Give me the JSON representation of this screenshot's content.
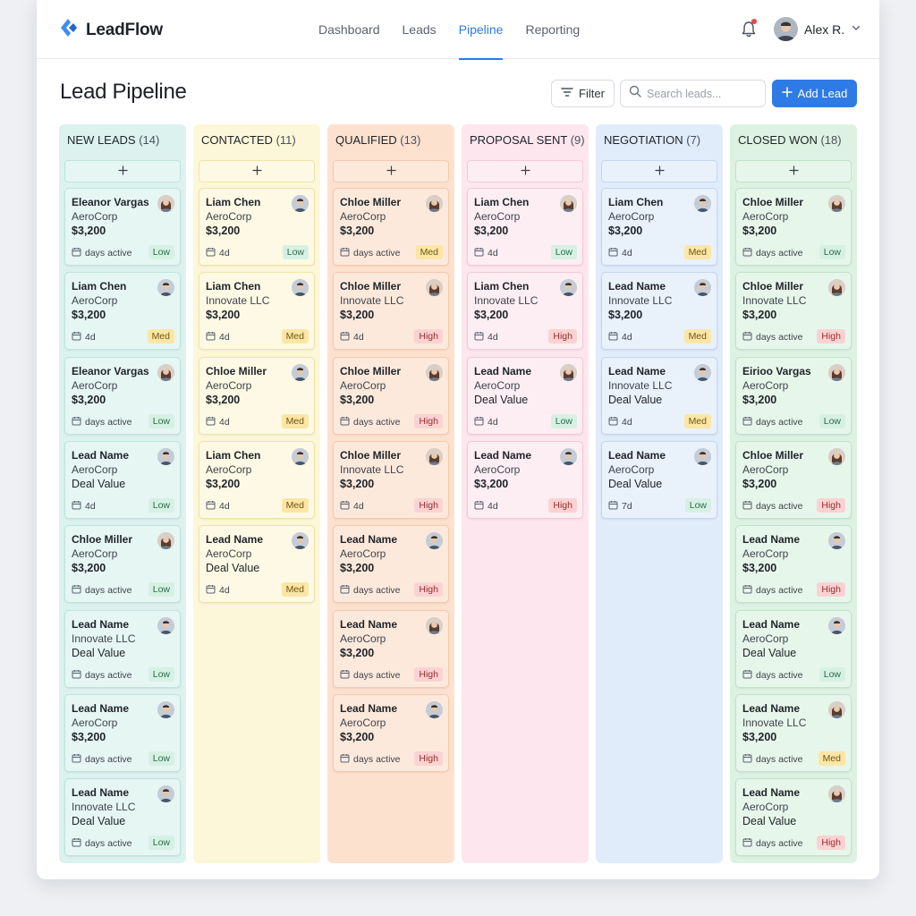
{
  "app": {
    "name": "LeadFlow"
  },
  "nav": [
    {
      "label": "Dashboard",
      "active": false
    },
    {
      "label": "Leads",
      "active": false
    },
    {
      "label": "Pipeline",
      "active": true
    },
    {
      "label": "Reporting",
      "active": false
    }
  ],
  "user": {
    "name": "Alex R."
  },
  "page": {
    "title": "Lead Pipeline"
  },
  "toolbar": {
    "filter_label": "Filter",
    "search_placeholder": "Search leads...",
    "add_label": "Add Lead"
  },
  "colors": {
    "accent": "#2f7be5",
    "notification": "#e5484d"
  },
  "columns": [
    {
      "title": "NEW LEADS",
      "count": "(14)",
      "bg": "#dcf2ef",
      "card_bg": "#e6f6f3",
      "border": "#bfe3dc",
      "cards": [
        {
          "name": "Eleanor Vargas",
          "company": "AeroCorp",
          "value": "$3,200",
          "meta": "days active",
          "priority": "Low",
          "avatar": "f"
        },
        {
          "name": "Liam Chen",
          "company": "AeroCorp",
          "value": "$3,200",
          "meta": "4d",
          "priority": "Med",
          "avatar": "m"
        },
        {
          "name": "Eleanor Vargas",
          "company": "AeroCorp",
          "value": "$3,200",
          "meta": "days active",
          "priority": "Low",
          "avatar": "f"
        },
        {
          "name": "Lead Name",
          "company": "AeroCorp",
          "value": "Deal Value",
          "meta": "4d",
          "priority": "Low",
          "avatar": "m"
        },
        {
          "name": "Chloe Miller",
          "company": "AeroCorp",
          "value": "$3,200",
          "meta": "days active",
          "priority": "Low",
          "avatar": "f"
        },
        {
          "name": "Lead Name",
          "company": "Innovate LLC",
          "value": "Deal Value",
          "meta": "days active",
          "priority": "Low",
          "avatar": "m"
        },
        {
          "name": "Lead Name",
          "company": "AeroCorp",
          "value": "$3,200",
          "meta": "days active",
          "priority": "Low",
          "avatar": "m"
        },
        {
          "name": "Lead Name",
          "company": "Innovate LLC",
          "value": "Deal Value",
          "meta": "days active",
          "priority": "Low",
          "avatar": "m"
        }
      ]
    },
    {
      "title": "CONTACTED",
      "count": "(11)",
      "bg": "#fdf7d9",
      "card_bg": "#fdf9e4",
      "border": "#f1e3a6",
      "cards": [
        {
          "name": "Liam Chen",
          "company": "AeroCorp",
          "value": "$3,200",
          "meta": "4d",
          "priority": "Low",
          "avatar": "m"
        },
        {
          "name": "Liam Chen",
          "company": "Innovate LLC",
          "value": "$3,200",
          "meta": "4d",
          "priority": "Med",
          "avatar": "m"
        },
        {
          "name": "Chloe Miller",
          "company": "AeroCorp",
          "value": "$3,200",
          "meta": "4d",
          "priority": "Med",
          "avatar": "m"
        },
        {
          "name": "Liam Chen",
          "company": "AeroCorp",
          "value": "$3,200",
          "meta": "4d",
          "priority": "Med",
          "avatar": "m"
        },
        {
          "name": "Lead Name",
          "company": "AeroCorp",
          "value": "Deal Value",
          "meta": "4d",
          "priority": "Med",
          "avatar": "m"
        }
      ]
    },
    {
      "title": "QUALIFIED",
      "count": "(13)",
      "bg": "#fde1cf",
      "card_bg": "#fde9dc",
      "border": "#f5c9ac",
      "cards": [
        {
          "name": "Chloe Miller",
          "company": "AeroCorp",
          "value": "$3,200",
          "meta": "days active",
          "priority": "Med",
          "avatar": "f"
        },
        {
          "name": "Chloe Miller",
          "company": "Innovate LLC",
          "value": "$3,200",
          "meta": "4d",
          "priority": "High",
          "avatar": "f"
        },
        {
          "name": "Chloe Miller",
          "company": "AeroCorp",
          "value": "$3,200",
          "meta": "days active",
          "priority": "High",
          "avatar": "f"
        },
        {
          "name": "Chloe Miller",
          "company": "Innovate LLC",
          "value": "$3,200",
          "meta": "4d",
          "priority": "High",
          "avatar": "f"
        },
        {
          "name": "Lead Name",
          "company": "AeroCorp",
          "value": "$3,200",
          "meta": "days active",
          "priority": "High",
          "avatar": "m"
        },
        {
          "name": "Lead Name",
          "company": "AeroCorp",
          "value": "$3,200",
          "meta": "days active",
          "priority": "High",
          "avatar": "f"
        },
        {
          "name": "Lead Name",
          "company": "AeroCorp",
          "value": "$3,200",
          "meta": "days active",
          "priority": "High",
          "avatar": "m"
        }
      ]
    },
    {
      "title": "PROPOSAL SENT",
      "count": "(9)",
      "bg": "#fde6ee",
      "card_bg": "#fdeef3",
      "border": "#f4c9d7",
      "cards": [
        {
          "name": "Liam Chen",
          "company": "AeroCorp",
          "value": "$3,200",
          "meta": "4d",
          "priority": "Low",
          "avatar": "f"
        },
        {
          "name": "Liam Chen",
          "company": "Innovate LLC",
          "value": "$3,200",
          "meta": "4d",
          "priority": "High",
          "avatar": "m"
        },
        {
          "name": "Lead Name",
          "company": "AeroCorp",
          "value": "Deal Value",
          "meta": "4d",
          "priority": "Low",
          "avatar": "f"
        },
        {
          "name": "Lead Name",
          "company": "AeroCorp",
          "value": "$3,200",
          "meta": "4d",
          "priority": "High",
          "avatar": "m"
        }
      ]
    },
    {
      "title": "NEGOTIATION",
      "count": "(7)",
      "bg": "#e1ecfa",
      "card_bg": "#e9f1fb",
      "border": "#c4d6ef",
      "cards": [
        {
          "name": "Liam Chen",
          "company": "AeroCorp",
          "value": "$3,200",
          "meta": "4d",
          "priority": "Med",
          "avatar": "m"
        },
        {
          "name": "Lead Name",
          "company": "Innovate LLC",
          "value": "$3,200",
          "meta": "4d",
          "priority": "Med",
          "avatar": "m"
        },
        {
          "name": "Lead Name",
          "company": "Innovate LLC",
          "value": "Deal Value",
          "meta": "4d",
          "priority": "Med",
          "avatar": "m"
        },
        {
          "name": "Lead Name",
          "company": "AeroCorp",
          "value": "Deal Value",
          "meta": "7d",
          "priority": "Low",
          "avatar": "m"
        }
      ]
    },
    {
      "title": "CLOSED WON",
      "count": "(18)",
      "bg": "#def2e4",
      "card_bg": "#e7f6eb",
      "border": "#c0e2ca",
      "cards": [
        {
          "name": "Chloe Miller",
          "company": "AeroCorp",
          "value": "$3,200",
          "meta": "days active",
          "priority": "Low",
          "avatar": "f"
        },
        {
          "name": "Chloe Miller",
          "company": "Innovate LLC",
          "value": "$3,200",
          "meta": "days active",
          "priority": "High",
          "avatar": "f"
        },
        {
          "name": "Eirioo Vargas",
          "company": "AeroCorp",
          "value": "$3,200",
          "meta": "days active",
          "priority": "Low",
          "avatar": "f"
        },
        {
          "name": "Chloe Miller",
          "company": "AeroCorp",
          "value": "$3,200",
          "meta": "days active",
          "priority": "High",
          "avatar": "f"
        },
        {
          "name": "Lead Name",
          "company": "AeroCorp",
          "value": "$3,200",
          "meta": "days active",
          "priority": "High",
          "avatar": "m"
        },
        {
          "name": "Lead Name",
          "company": "AeroCorp",
          "value": "Deal Value",
          "meta": "days active",
          "priority": "Low",
          "avatar": "m"
        },
        {
          "name": "Lead Name",
          "company": "Innovate LLC",
          "value": "$3,200",
          "meta": "days active",
          "priority": "Med",
          "avatar": "f"
        },
        {
          "name": "Lead Name",
          "company": "AeroCorp",
          "value": "Deal Value",
          "meta": "days active",
          "priority": "High",
          "avatar": "f"
        }
      ]
    }
  ]
}
